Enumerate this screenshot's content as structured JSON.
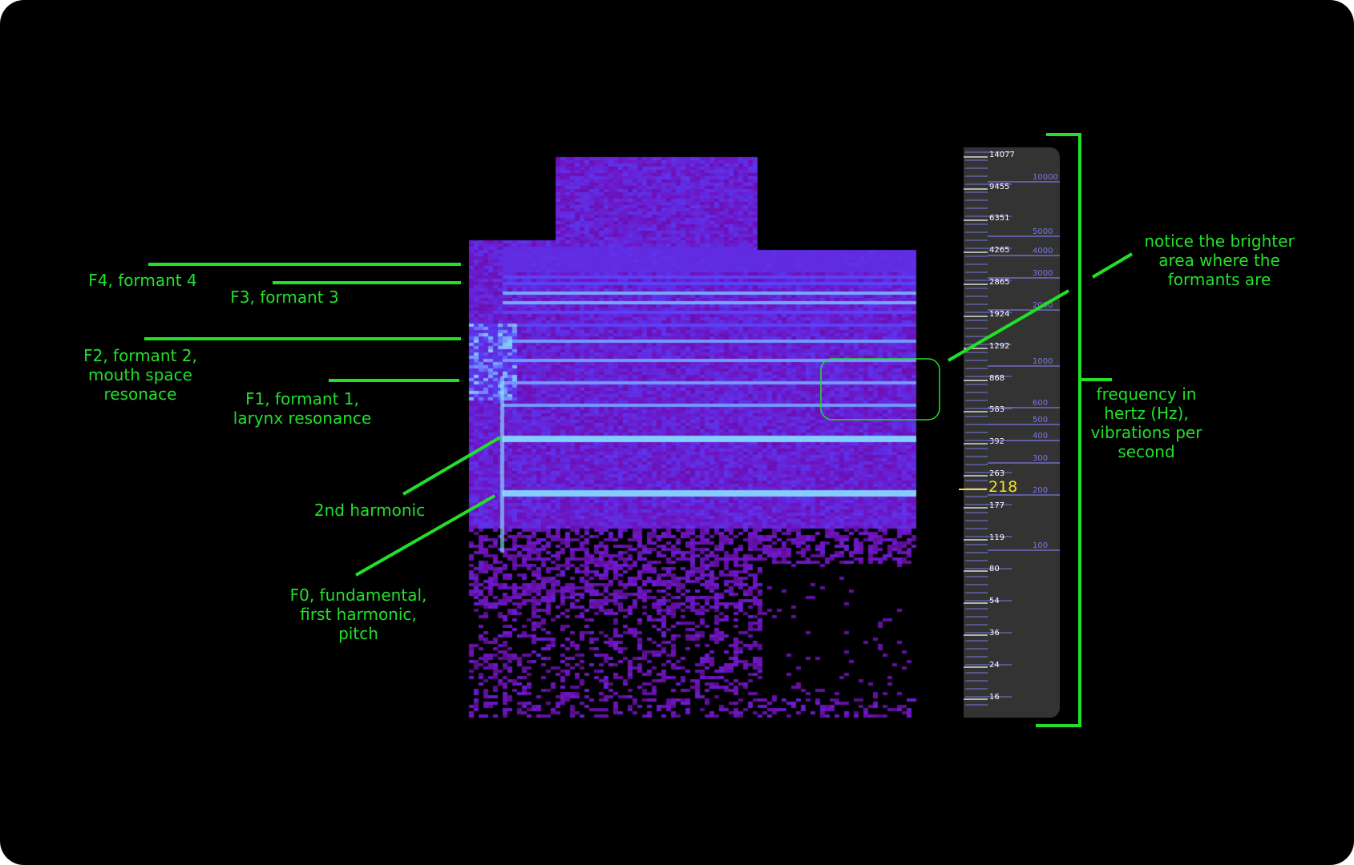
{
  "annotations": {
    "f4": "F4, formant 4",
    "f3": "F3, formant 3",
    "f2": "F2, formant 2,\nmouth space\nresonace",
    "f1": "F1, formant 1,\nlarynx resonance",
    "h2": "2nd harmonic",
    "f0": "F0, fundamental,\nfirst harmonic,\npitch",
    "notice": "notice the brighter\narea where the\nformants are",
    "frequency": "frequency in\nhertz (Hz),\nvibrations per\nsecond"
  },
  "scale": {
    "left_ticks": [
      "14077",
      "9455",
      "6351",
      "4265",
      "2865",
      "1924",
      "1292",
      "868",
      "583",
      "392",
      "263",
      "177",
      "119",
      "80",
      "54",
      "36",
      "24",
      "16"
    ],
    "right_ticks": [
      "10000",
      "5000",
      "4000",
      "3000",
      "2000",
      "1000",
      "600",
      "500",
      "400",
      "300",
      "200",
      "100"
    ],
    "pitch_value": "218"
  },
  "colors": {
    "annotation": "#22e02a",
    "pitch": "#f2e22a",
    "scale_text": "#ffffff",
    "scale_secondary": "#7b78e0",
    "spectrogram_low": "#3a0a4a",
    "spectrogram_mid": "#6a1fd8",
    "spectrogram_high": "#8ef2ff"
  }
}
